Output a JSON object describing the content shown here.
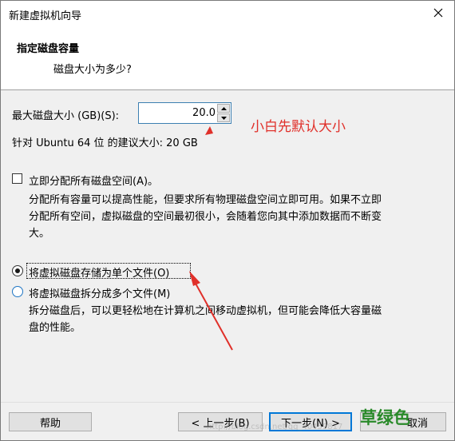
{
  "window": {
    "title": "新建虚拟机向导"
  },
  "header": {
    "title": "指定磁盘容量",
    "subtitle": "磁盘大小为多少?"
  },
  "disk": {
    "size_label": "最大磁盘大小 (GB)(S):",
    "size_value": "20.0",
    "recommend": "针对 Ubuntu 64 位 的建议大小: 20 GB"
  },
  "allocate": {
    "label": "立即分配所有磁盘空间(A)。",
    "checked": false,
    "desc_line1": "分配所有容量可以提高性能，但要求所有物理磁盘空间立即可用。如果不立即",
    "desc_line2": "分配所有空间，虚拟磁盘的空间最初很小，会随着您向其中添加数据而不断变",
    "desc_line3": "大。"
  },
  "storage": {
    "single_label": "将虚拟磁盘存储为单个文件(O)",
    "multi_label": "将虚拟磁盘拆分成多个文件(M)",
    "selected": "single",
    "multi_desc_line1": "拆分磁盘后，可以更轻松地在计算机之间移动虚拟机，但可能会降低大容量磁",
    "multi_desc_line2": "盘的性能。"
  },
  "buttons": {
    "help": "帮助",
    "back": "< 上一步(B)",
    "next": "下一步(N) >",
    "cancel": "取消"
  },
  "annotations": {
    "red_note": "小白先默认大小",
    "green_note": "草绿色",
    "watermark": "http://blog.csdn.net/qq_40459817",
    "red_color": "#e0302a",
    "green_color": "#2a8a2a"
  }
}
